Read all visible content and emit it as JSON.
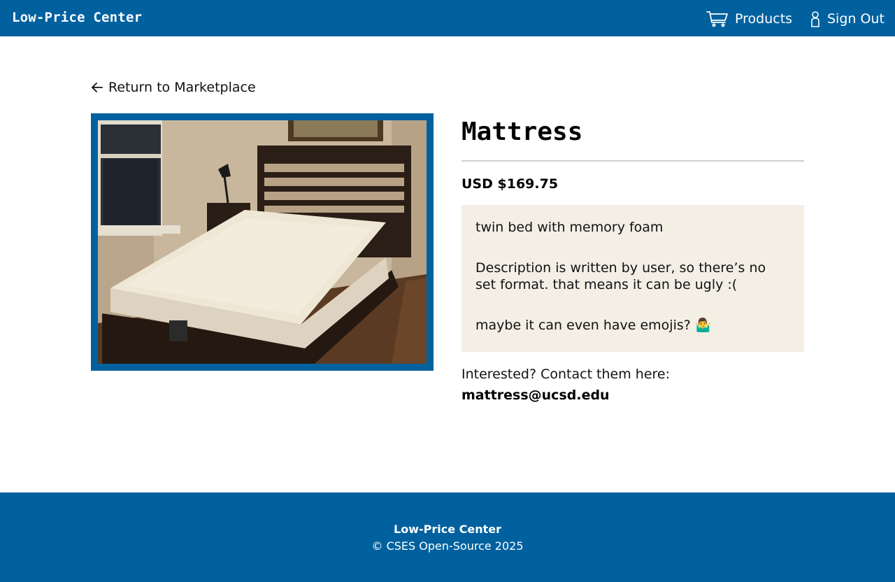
{
  "header": {
    "brand": "Low-Price Center",
    "nav": {
      "products_label": "Products",
      "products_icon": "cart-icon",
      "signout_label": "Sign Out",
      "signout_icon": "person-icon"
    }
  },
  "back_link": {
    "label": "Return to Marketplace",
    "icon": "arrow-left-icon"
  },
  "product": {
    "image_alt": "Mattress",
    "title": "Mattress",
    "price": "USD $169.75",
    "description": [
      "twin bed with memory foam",
      "Description is written by user, so there’s no set format. that means it can  be ugly :(",
      "maybe it can  even have emojis? 🤷‍♂️"
    ],
    "contact_label": "Interested? Contact them here:",
    "contact_email": "mattress@ucsd.edu"
  },
  "footer": {
    "title": "Low-Price Center",
    "copyright": "© CSES Open-Source 2025"
  },
  "colors": {
    "brand_blue": "#01619f",
    "description_bg": "#f3efe5",
    "rule": "#cfcfcf"
  }
}
